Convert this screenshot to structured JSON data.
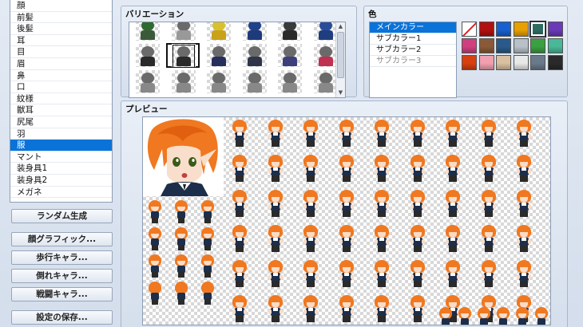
{
  "parts_list": {
    "items": [
      {
        "label": "顔",
        "selected": false
      },
      {
        "label": "前髪",
        "selected": false
      },
      {
        "label": "後髪",
        "selected": false
      },
      {
        "label": "耳",
        "selected": false
      },
      {
        "label": "目",
        "selected": false
      },
      {
        "label": "眉",
        "selected": false
      },
      {
        "label": "鼻",
        "selected": false
      },
      {
        "label": "口",
        "selected": false
      },
      {
        "label": "紋様",
        "selected": false
      },
      {
        "label": "獣耳",
        "selected": false
      },
      {
        "label": "尻尾",
        "selected": false
      },
      {
        "label": "羽",
        "selected": false
      },
      {
        "label": "服",
        "selected": true
      },
      {
        "label": "マント",
        "selected": false
      },
      {
        "label": "装身具1",
        "selected": false
      },
      {
        "label": "装身具2",
        "selected": false
      },
      {
        "label": "メガネ",
        "selected": false
      }
    ]
  },
  "buttons": {
    "random": "ランダム生成",
    "face_graphic": "顔グラフィック...",
    "walk_chara": "歩行キャラ...",
    "fallen_chara": "倒れキャラ...",
    "battle_chara": "戦闘キャラ...",
    "save_settings": "設定の保存..."
  },
  "variation": {
    "title": "バリエーション",
    "selected_index": 7,
    "cells": [
      {
        "body": "#3b5a3a",
        "hat": "#2f6b2f"
      },
      {
        "body": "#999999",
        "hat": null
      },
      {
        "body": "#c9a21a",
        "hat": "#d8c030"
      },
      {
        "body": "#1e3a7a",
        "hat": "#20408a"
      },
      {
        "body": "#2a2a2a",
        "hat": "#3a3a3a"
      },
      {
        "body": "#1f3e80",
        "hat": "#2a4d99"
      },
      {
        "body": "#2a2a2a",
        "hat": null
      },
      {
        "body": "#2a2a2a",
        "hat": null
      },
      {
        "body": "#262f5c",
        "hat": null
      },
      {
        "body": "#30354a",
        "hat": null
      },
      {
        "body": "#3c3f7c",
        "hat": null
      },
      {
        "body": "#c03050",
        "hat": null
      },
      {
        "body": "#888888",
        "hat": null
      },
      {
        "body": "#888888",
        "hat": null
      },
      {
        "body": "#888888",
        "hat": null
      },
      {
        "body": "#888888",
        "hat": null
      },
      {
        "body": "#888888",
        "hat": null
      },
      {
        "body": "#888888",
        "hat": null
      }
    ]
  },
  "color": {
    "title": "色",
    "items": [
      {
        "label": "メインカラー",
        "state": "selected"
      },
      {
        "label": "サブカラー1",
        "state": "normal"
      },
      {
        "label": "サブカラー2",
        "state": "normal"
      },
      {
        "label": "サブカラー3",
        "state": "disabled"
      }
    ],
    "swatches": [
      {
        "type": "none",
        "color": "#ffffff"
      },
      {
        "type": "color",
        "color": "#b01010"
      },
      {
        "type": "color",
        "color": "#1860d0"
      },
      {
        "type": "color",
        "color": "#e8a000"
      },
      {
        "type": "color",
        "color": "#2e6b60",
        "selected": true
      },
      {
        "type": "color",
        "color": "#6a3ab8"
      },
      {
        "type": "color",
        "color": "#d04080"
      },
      {
        "type": "color",
        "color": "#8a5a38"
      },
      {
        "type": "color",
        "color": "#2a5a8a"
      },
      {
        "type": "color",
        "color": "#b8c0c8"
      },
      {
        "type": "color",
        "color": "#3aa040"
      },
      {
        "type": "color",
        "color": "#48b898"
      },
      {
        "type": "color",
        "color": "#d84010"
      },
      {
        "type": "color",
        "color": "#f0a0b0"
      },
      {
        "type": "color",
        "color": "#d8c0a0"
      },
      {
        "type": "color",
        "color": "#e8e8e8"
      },
      {
        "type": "color",
        "color": "#6a7a8a"
      },
      {
        "type": "color",
        "color": "#2a2a2a"
      }
    ]
  },
  "preview": {
    "title": "プレビュー",
    "hair_color": "#f07820"
  }
}
